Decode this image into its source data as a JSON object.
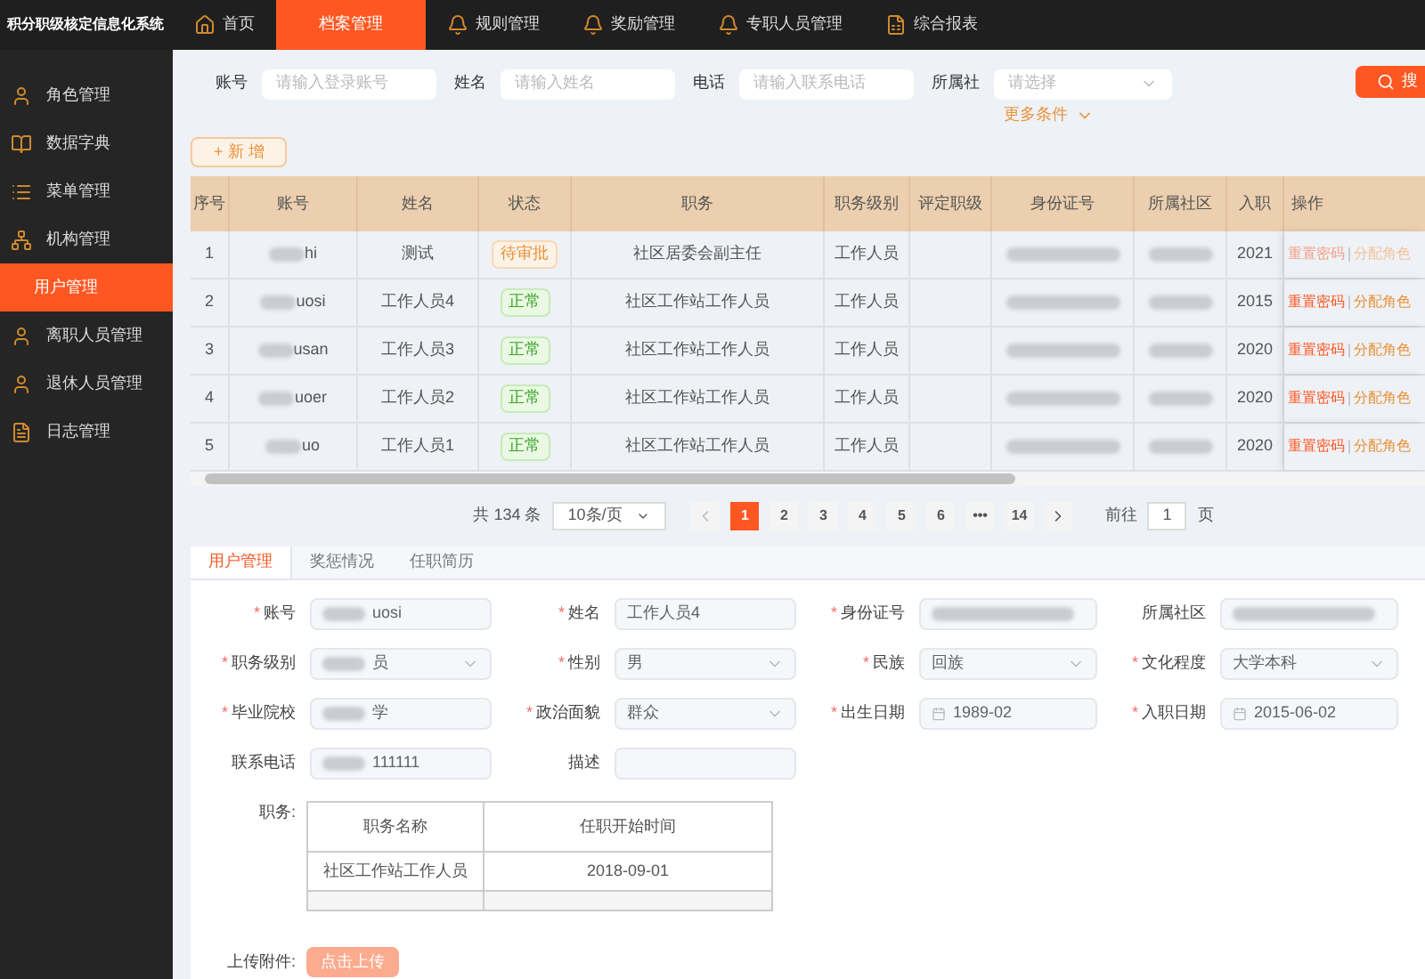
{
  "app_title": "积分职级核定信息化系统",
  "top_nav": [
    {
      "label": "首页",
      "selected": false
    },
    {
      "label": "档案管理",
      "selected": true
    },
    {
      "label": "规则管理",
      "selected": false
    },
    {
      "label": "奖励管理",
      "selected": false
    },
    {
      "label": "专职人员管理",
      "selected": false
    },
    {
      "label": "综合报表",
      "selected": false
    }
  ],
  "sidebar": {
    "items": [
      {
        "label": "角色管理",
        "selected": false
      },
      {
        "label": "数据字典",
        "selected": false
      },
      {
        "label": "菜单管理",
        "selected": false
      },
      {
        "label": "机构管理",
        "selected": false
      },
      {
        "label": "用户管理",
        "selected": true
      },
      {
        "label": "离职人员管理",
        "selected": false
      },
      {
        "label": "退休人员管理",
        "selected": false
      },
      {
        "label": "日志管理",
        "selected": false
      }
    ]
  },
  "search": {
    "fields": [
      {
        "label": "账号",
        "placeholder": "请输入登录账号",
        "kind": "input"
      },
      {
        "label": "姓名",
        "placeholder": "请输入姓名",
        "kind": "input"
      },
      {
        "label": "电话",
        "placeholder": "请输入联系电话",
        "kind": "input"
      },
      {
        "label": "所属社",
        "placeholder": "请选择",
        "kind": "select"
      }
    ],
    "search_button": "搜",
    "more": "更多条件"
  },
  "add_button": "+ 新 增",
  "table": {
    "columns": [
      "序号",
      "账号",
      "姓名",
      "状态",
      "职务",
      "职务级别",
      "评定职级",
      "身份证号",
      "所属社区",
      "入职",
      "操作"
    ],
    "rows": [
      {
        "cells": [
          "1",
          "hi",
          "测试",
          "待审批",
          "社区居委会副主任",
          "工作人员",
          "",
          "",
          "",
          "2021"
        ],
        "kind": "pending",
        "actions": [
          "重置密码",
          "分配角色"
        ]
      },
      {
        "cells": [
          "2",
          "uosi",
          "工作人员4",
          "正常",
          "社区工作站工作人员",
          "工作人员",
          "",
          "",
          "",
          "2015"
        ],
        "kind": "normal",
        "actions": [
          "重置密码",
          "分配角色"
        ]
      },
      {
        "cells": [
          "3",
          "usan",
          "工作人员3",
          "正常",
          "社区工作站工作人员",
          "工作人员",
          "",
          "",
          "",
          "2020"
        ],
        "kind": "normal",
        "actions": [
          "重置密码",
          "分配角色"
        ]
      },
      {
        "cells": [
          "4",
          "uoer",
          "工作人员2",
          "正常",
          "社区工作站工作人员",
          "工作人员",
          "",
          "",
          "",
          "2020"
        ],
        "kind": "normal",
        "actions": [
          "重置密码",
          "分配角色"
        ]
      },
      {
        "cells": [
          "5",
          "uo",
          "工作人员1",
          "正常",
          "社区工作站工作人员",
          "工作人员",
          "",
          "",
          "",
          "2020"
        ],
        "kind": "normal",
        "actions": [
          "重置密码",
          "分配角色"
        ]
      }
    ]
  },
  "pagination": {
    "total": "共 134 条",
    "page_size": "10条/页",
    "pages": [
      {
        "label": "1",
        "selected": true
      },
      {
        "label": "2",
        "selected": false
      },
      {
        "label": "3",
        "selected": false
      },
      {
        "label": "4",
        "selected": false
      },
      {
        "label": "5",
        "selected": false
      },
      {
        "label": "6",
        "selected": false
      },
      {
        "label": "•••",
        "selected": false
      },
      {
        "label": "14",
        "selected": false
      }
    ],
    "goto_label": "前往",
    "goto_value": "1",
    "page_label": "页"
  },
  "detail_tabs": [
    {
      "label": "用户管理",
      "selected": true
    },
    {
      "label": "奖惩情况",
      "selected": false
    },
    {
      "label": "任职简历",
      "selected": false
    }
  ],
  "form": [
    {
      "label": "账号",
      "required_mark": "*",
      "value": "uosi",
      "kind": "input",
      "redacted": true
    },
    {
      "label": "姓名",
      "required_mark": "*",
      "value": "工作人员4",
      "kind": "input",
      "redacted": false
    },
    {
      "label": "身份证号",
      "required_mark": "*",
      "kind": "input",
      "redacted": true
    },
    {
      "label": "所属社区",
      "kind": "select",
      "redacted": true
    },
    {
      "label": "职务级别",
      "required_mark": "*",
      "value": "员",
      "kind": "select",
      "redacted": true
    },
    {
      "label": "性别",
      "required_mark": "*",
      "value": "男",
      "kind": "select",
      "redacted": false
    },
    {
      "label": "民族",
      "required_mark": "*",
      "value": "回族",
      "kind": "select",
      "redacted": false
    },
    {
      "label": "文化程度",
      "required_mark": "*",
      "value": "大学本科",
      "kind": "select",
      "redacted": false
    },
    {
      "label": "毕业院校",
      "required_mark": "*",
      "value": "学",
      "kind": "input",
      "redacted": true
    },
    {
      "label": "政治面貌",
      "required_mark": "*",
      "value": "群众",
      "kind": "select",
      "redacted": false
    },
    {
      "label": "出生日期",
      "required_mark": "*",
      "value": "1989-02",
      "kind": "date",
      "redacted": false
    },
    {
      "label": "入职日期",
      "required_mark": "*",
      "value": "2015-06-02",
      "kind": "date",
      "redacted": false
    },
    {
      "label": "联系电话",
      "value": "111111",
      "kind": "input",
      "redacted": true
    },
    {
      "label": "描述",
      "kind": "input",
      "redacted": false
    }
  ],
  "duties": {
    "label": "职务:",
    "columns": [
      "职务名称",
      "任职开始时间"
    ],
    "rows": [
      [
        "社区工作站工作人员",
        "2018-09-01"
      ],
      [
        null,
        null
      ]
    ]
  },
  "upload": {
    "label": "上传附件:",
    "button": "点击上传"
  }
}
